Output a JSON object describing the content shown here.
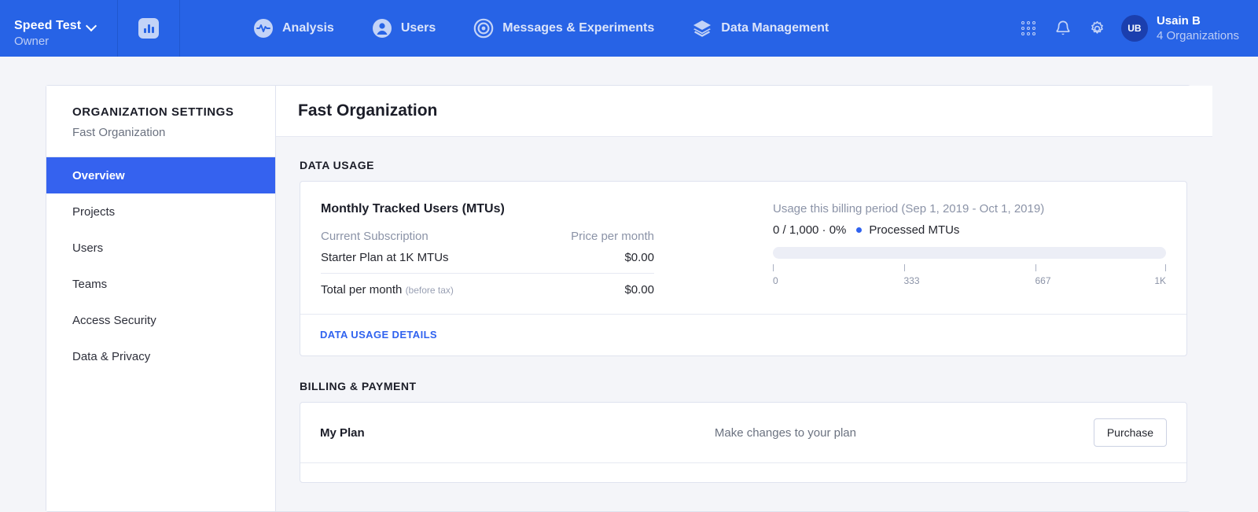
{
  "topnav": {
    "org_name": "Speed Test",
    "org_role": "Owner",
    "app_icon": "bar-chart-icon",
    "items": [
      {
        "label": "Analysis",
        "icon": "pulse-circle-icon"
      },
      {
        "label": "Users",
        "icon": "person-circle-icon"
      },
      {
        "label": "Messages & Experiments",
        "icon": "target-icon"
      },
      {
        "label": "Data Management",
        "icon": "layers-icon"
      }
    ],
    "right_icons": [
      {
        "name": "apps-grid-icon"
      },
      {
        "name": "notification-bell-icon"
      },
      {
        "name": "settings-gear-icon"
      }
    ],
    "avatar_initials": "UB",
    "user_name": "Usain B",
    "user_orgs": "4 Organizations",
    "bg_color": "#2763e6"
  },
  "sidebar": {
    "title": "ORGANIZATION SETTINGS",
    "subtitle": "Fast Organization",
    "active_index": 0,
    "items": [
      {
        "label": "Overview"
      },
      {
        "label": "Projects"
      },
      {
        "label": "Users"
      },
      {
        "label": "Teams"
      },
      {
        "label": "Access Security"
      },
      {
        "label": "Data & Privacy"
      }
    ],
    "active_color": "#3562ef"
  },
  "main": {
    "page_title": "Fast Organization",
    "data_usage": {
      "section_label": "DATA USAGE",
      "card_title": "Monthly Tracked Users (MTUs)",
      "col_subscription": "Current Subscription",
      "col_price": "Price per month",
      "plan_name": "Starter Plan at 1K MTUs",
      "plan_price": "$0.00",
      "total_label": "Total per month",
      "total_note": "(before tax)",
      "total_price": "$0.00",
      "period_label": "Usage this billing period (Sep 1, 2019 - Oct 1, 2019)",
      "stats_text": "0 / 1,000 · 0%",
      "legend_label": "Processed MTUs",
      "legend_color": "#2f62ef",
      "details_link": "DATA USAGE DETAILS"
    },
    "billing": {
      "section_label": "BILLING & PAYMENT",
      "row_label": "My Plan",
      "row_desc": "Make changes to your plan",
      "button_label": "Purchase"
    }
  },
  "chart_data": {
    "type": "bar",
    "title": "Usage this billing period (Sep 1, 2019 - Oct 1, 2019)",
    "series": [
      {
        "name": "Processed MTUs",
        "values": [
          0
        ],
        "color": "#2f62ef"
      }
    ],
    "used": 0,
    "limit": 1000,
    "percent": 0,
    "xlabel": "",
    "ylabel": "",
    "xlim": [
      0,
      1000
    ],
    "ticks": [
      {
        "value": 0,
        "label": "0"
      },
      {
        "value": 333,
        "label": "333"
      },
      {
        "value": 667,
        "label": "667"
      },
      {
        "value": 1000,
        "label": "1K"
      }
    ],
    "grid": false,
    "legend": "inline"
  }
}
